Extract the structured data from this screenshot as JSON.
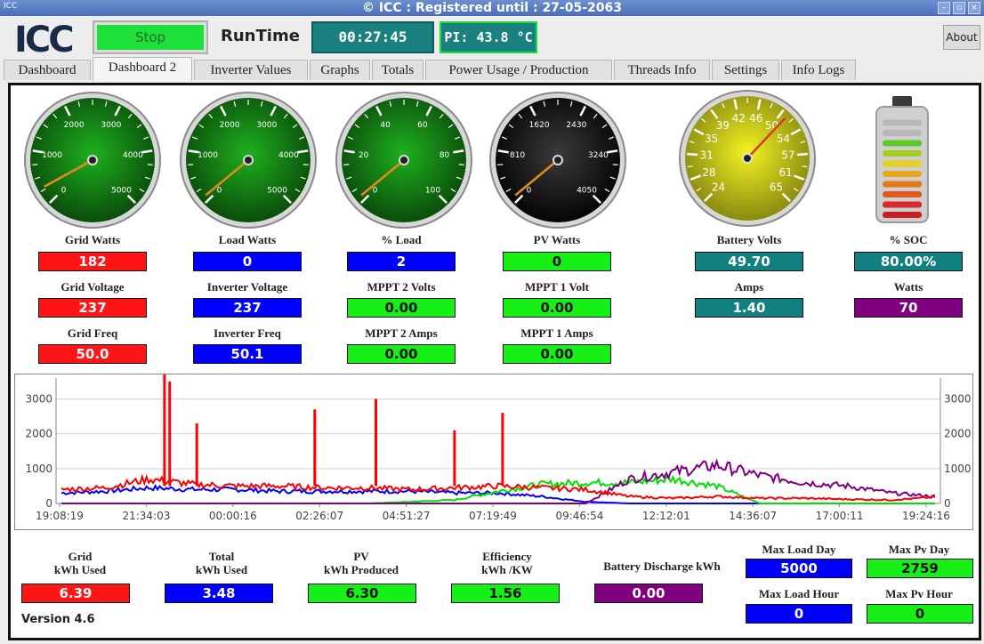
{
  "window": {
    "icon_text": "ICC",
    "title": "© ICC : Registered until : 27-05-2063"
  },
  "toolbar": {
    "logo": "ICC",
    "stop_label": "Stop",
    "runtime_label": "RunTime",
    "runtime_value": "00:27:45",
    "pi_value": "PI: 43.8 °C",
    "about_label": "About"
  },
  "tabs": [
    "Dashboard",
    "Dashboard 2",
    "Inverter Values",
    "Graphs",
    "Totals",
    "Power Usage / Production",
    "Threads Info",
    "Settings",
    "Info Logs"
  ],
  "active_tab": "Dashboard 2",
  "gauges": [
    {
      "name": "grid-watts-gauge",
      "face": "green",
      "labels": [
        "0",
        "1000",
        "2000",
        "3000",
        "4000",
        "5000"
      ],
      "value_fraction": 0.06
    },
    {
      "name": "load-watts-gauge",
      "face": "green",
      "labels": [
        "0",
        "1000",
        "2000",
        "3000",
        "4000",
        "5000"
      ],
      "value_fraction": 0.02
    },
    {
      "name": "percent-load-gauge",
      "face": "green",
      "labels": [
        "0",
        "20",
        "40",
        "60",
        "80",
        "100"
      ],
      "value_fraction": 0.02
    },
    {
      "name": "pv-watts-gauge",
      "face": "black",
      "labels": [
        "0",
        "810",
        "1620",
        "2430",
        "3240",
        "4050"
      ],
      "value_fraction": 0.02
    },
    {
      "name": "battery-volts-gauge",
      "face": "yellow",
      "labels": [
        "24",
        "28",
        "31",
        "35",
        "39",
        "42",
        "46",
        "50",
        "54",
        "57",
        "61",
        "65"
      ],
      "value_fraction": 0.66
    }
  ],
  "readings": {
    "grid_watts": {
      "label": "Grid Watts",
      "value": "182"
    },
    "load_watts": {
      "label": "Load Watts",
      "value": "0"
    },
    "percent_load": {
      "label": "% Load",
      "value": "2"
    },
    "pv_watts": {
      "label": "PV Watts",
      "value": "0"
    },
    "battery_volts": {
      "label": "Battery Volts",
      "value": "49.70"
    },
    "soc": {
      "label": "% SOC",
      "value": "80.00%"
    },
    "grid_voltage": {
      "label": "Grid Voltage",
      "value": "237"
    },
    "inverter_voltage": {
      "label": "Inverter Voltage",
      "value": "237"
    },
    "mppt2_volts": {
      "label": "MPPT 2 Volts",
      "value": "0.00"
    },
    "mppt1_volt": {
      "label": "MPPT 1 Volt",
      "value": "0.00"
    },
    "amps": {
      "label": "Amps",
      "value": "1.40"
    },
    "watts": {
      "label": "Watts",
      "value": "70"
    },
    "grid_freq": {
      "label": "Grid Freq",
      "value": "50.0"
    },
    "inverter_freq": {
      "label": "Inverter Freq",
      "value": "50.1"
    },
    "mppt2_amps": {
      "label": "MPPT 2 Amps",
      "value": "0.00"
    },
    "mppt1_amps": {
      "label": "MPPT 1 Amps",
      "value": "0.00"
    }
  },
  "battery_soc_fraction": 0.8,
  "chart_data": {
    "type": "line",
    "title": "",
    "xlabel": "",
    "ylabel": "",
    "categories": [
      "19:08:19",
      "21:34:03",
      "00:00:16",
      "02:26:07",
      "04:51:27",
      "07:19:49",
      "09:46:54",
      "12:12:01",
      "14:36:07",
      "17:00:11",
      "19:24:16"
    ],
    "y_ticks": [
      0,
      1000,
      2000,
      3000
    ],
    "ylim": [
      0,
      3600
    ],
    "grid": true,
    "series": [
      {
        "color": "#ff0000",
        "values": [
          400,
          450,
          700,
          550,
          500,
          500,
          450,
          450,
          400,
          450,
          500,
          450,
          400,
          200,
          150,
          200,
          150,
          150,
          120,
          100,
          180
        ]
      },
      {
        "color": "#0000ff",
        "values": [
          300,
          350,
          450,
          400,
          400,
          350,
          350,
          350,
          350,
          300,
          300,
          200,
          50,
          0,
          0,
          0,
          0,
          0,
          0,
          0,
          0
        ]
      },
      {
        "color": "#00e000",
        "values": [
          0,
          0,
          0,
          0,
          0,
          0,
          0,
          0,
          50,
          100,
          350,
          550,
          600,
          600,
          700,
          500,
          0,
          0,
          0,
          0,
          0
        ]
      },
      {
        "color": "#800080",
        "values": [
          0,
          0,
          0,
          0,
          0,
          0,
          0,
          0,
          0,
          0,
          0,
          0,
          0,
          700,
          900,
          1100,
          800,
          600,
          500,
          300,
          200
        ]
      }
    ],
    "peaks": [
      {
        "x_frac": 0.118,
        "y": 3700
      },
      {
        "x_frac": 0.124,
        "y": 3500
      },
      {
        "x_frac": 0.155,
        "y": 2300
      },
      {
        "x_frac": 0.29,
        "y": 2700
      },
      {
        "x_frac": 0.36,
        "y": 3000
      },
      {
        "x_frac": 0.45,
        "y": 2100
      },
      {
        "x_frac": 0.505,
        "y": 2600
      }
    ]
  },
  "totals": {
    "grid_kwh": {
      "label1": "Grid",
      "label2": "kWh Used",
      "value": "6.39"
    },
    "total_kwh": {
      "label1": "Total",
      "label2": "kWh Used",
      "value": "3.48"
    },
    "pv_kwh": {
      "label1": "PV",
      "label2": "kWh Produced",
      "value": "6.30"
    },
    "efficiency": {
      "label1": "Efficiency",
      "label2": "kWh /KW",
      "value": "1.56"
    },
    "battery_discharge": {
      "label": "Battery Discharge kWh",
      "value": "0.00"
    },
    "max_load_day": {
      "label": "Max Load Day",
      "value": "5000"
    },
    "max_pv_day": {
      "label": "Max Pv Day",
      "value": "2759"
    },
    "max_load_hour": {
      "label": "Max Load Hour",
      "value": "0"
    },
    "max_pv_hour": {
      "label": "Max Pv Hour",
      "value": "0"
    }
  },
  "version": "Version 4.6"
}
